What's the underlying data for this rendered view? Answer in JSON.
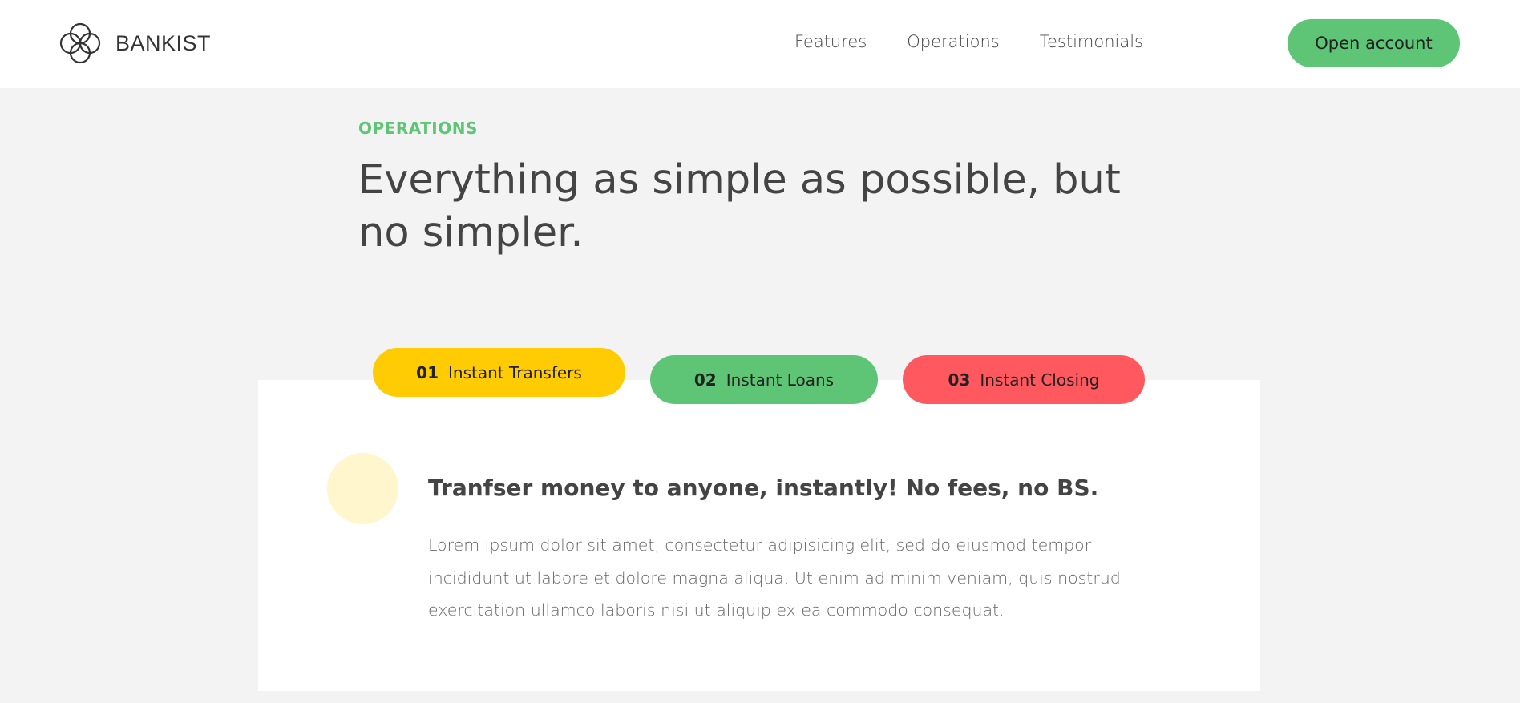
{
  "brand": {
    "name": "BANKIST",
    "logo_icon": "four-circles-logo-icon"
  },
  "nav": {
    "links": [
      {
        "label": "Features"
      },
      {
        "label": "Operations"
      },
      {
        "label": "Testimonials"
      }
    ],
    "cta_label": "Open account"
  },
  "section": {
    "label": "OPERATIONS",
    "title": "Everything as simple as possible, but no simpler."
  },
  "operations": {
    "tabs": [
      {
        "num": "01",
        "label": "Instant Transfers",
        "color": "#ffcb03",
        "active": true
      },
      {
        "num": "02",
        "label": "Instant Loans",
        "color": "#5ec576",
        "active": false
      },
      {
        "num": "03",
        "label": "Instant Closing",
        "color": "#ff585f",
        "active": false
      }
    ],
    "content": {
      "icon": "transfer-icon",
      "heading": "Tranfser money to anyone, instantly! No fees, no BS.",
      "text": "Lorem ipsum dolor sit amet, consectetur adipisicing elit, sed do eiusmod tempor incididunt ut labore et dolore magna aliqua. Ut enim ad minim veniam, quis nostrud exercitation ullamco laboris nisi ut aliquip ex ea commodo consequat."
    }
  },
  "colors": {
    "accent_green": "#5ec576",
    "accent_yellow": "#ffcb03",
    "accent_red": "#ff585f",
    "background": "#f3f3f3"
  }
}
